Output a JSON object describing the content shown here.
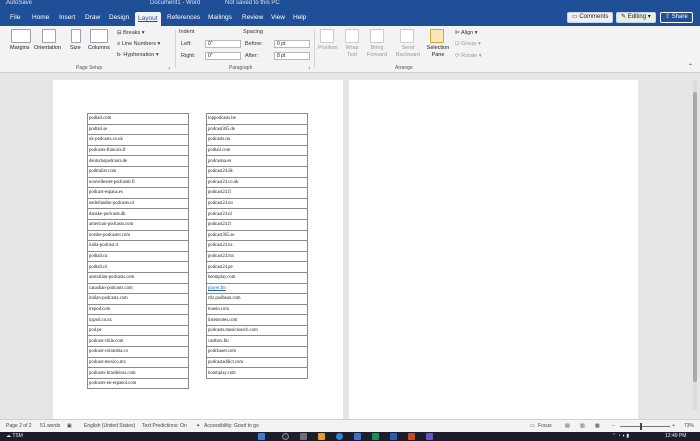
{
  "title_bar": {
    "autosave": "AutoSave",
    "doc_name": "Document1 - Word",
    "notice": "Not saved to this PC"
  },
  "menu": {
    "tabs": [
      "File",
      "Home",
      "Insert",
      "Draw",
      "Design",
      "Layout",
      "References",
      "Mailings",
      "Review",
      "View",
      "Help"
    ],
    "active_tab": "Layout",
    "comments": "Comments",
    "editing": "Editing",
    "share": "Share"
  },
  "ribbon": {
    "page_setup": {
      "margins": "Margins",
      "orientation": "Orientation",
      "size": "Size",
      "columns": "Columns",
      "breaks": "Breaks",
      "line_numbers": "Line Numbers",
      "hyphenation": "Hyphenation",
      "group_label": "Page Setup"
    },
    "paragraph": {
      "indent": "Indent",
      "left_label": "Left:",
      "left_value": "0\"",
      "right_label": "Right:",
      "right_value": "0\"",
      "spacing": "Spacing",
      "before_label": "Before:",
      "before_value": "0 pt",
      "after_label": "After:",
      "after_value": "8 pt",
      "group_label": "Paragraph"
    },
    "arrange": {
      "position": "Position",
      "wrap_text": "Wrap Text",
      "bring_forward": "Bring Forward",
      "send_backward": "Send Backward",
      "selection_pane": "Selection Pane",
      "align": "Align",
      "group": "Group",
      "rotate": "Rotate",
      "group_label": "Arrange"
    }
  },
  "table_left": [
    "podtail.com",
    "podtail.se",
    "uk-podcasts.co.uk",
    "podcasts-francais.fr",
    "deutschepodcasts.de",
    "podtrailer.com",
    "nouvellesset-podcastit.fi",
    "podcast-espana.es",
    "nederlandse-podcasts.nl",
    "danske-podcasts.dk",
    "american-podcasts.com",
    "norske-podcaster.com",
    "italia-podcast.it",
    "podtail.nz",
    "podtail.nl",
    "australian-podcasts.com",
    "canadian-podcasts.com",
    "indian-podcasts.com",
    "irepod.com",
    "nzpod.co.nz",
    "pod.pe",
    "podcast-chile.com",
    "podcast-colombia.co",
    "podcast-mexico.mx",
    "podcasts-brasileiros.com",
    "podcasts-en-espanol.com"
  ],
  "table_right": [
    "toppodcasts.be",
    "podcast365.de",
    "podcasts.nu",
    "podtail.com",
    "podcastsa.es",
    "podcast24.dk",
    "podcast24.co.uk",
    "podcast24.fi",
    "podcast24.no",
    "podcast24.nl",
    "podcast24.fr",
    "podcast365.se",
    "podcast24.nz",
    "podcast24.mx",
    "podcast24.pe",
    "beomplay.com",
    "player.fm",
    "rtlz.podbean.com",
    "tunein.com",
    "listennotes.com",
    "podcasts.musicsearch.com",
    "castbox.fm",
    "podchaser.com",
    "podcastaddict.com",
    "boomplay.com"
  ],
  "table_right_link_index": 16,
  "status": {
    "page": "Page 2 of 2",
    "words": "51 words",
    "language": "English (United States)",
    "predictions": "Text Predictions: On",
    "accessibility": "Accessibility: Good to go",
    "focus": "Focus",
    "zoom": "73%"
  },
  "taskbar": {
    "temp": "72°F",
    "weather": "TSM",
    "time": "12:49 PM"
  },
  "colors": {
    "word_blue": "#1f4f96",
    "link": "#1f5fbf"
  }
}
